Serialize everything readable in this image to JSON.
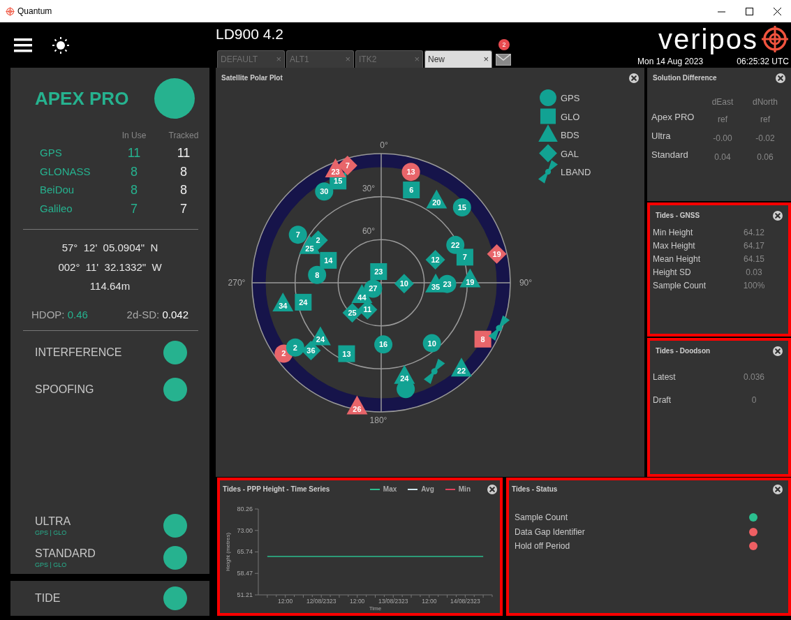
{
  "window": {
    "title": "Quantum"
  },
  "header": {
    "title": "LD900 4.2",
    "tabs": [
      {
        "label": "DEFAULT",
        "close": "×",
        "selected": false
      },
      {
        "label": "ALT1",
        "close": "×",
        "selected": false
      },
      {
        "label": "ITK2",
        "close": "×",
        "selected": false
      },
      {
        "label": "New",
        "close": "×",
        "selected": true
      }
    ],
    "messages": {
      "badge": "2"
    },
    "logo": "veripos",
    "date": "Mon 14 Aug 2023",
    "time": "06:25:32 UTC"
  },
  "receiver": {
    "name": "APEX PRO",
    "color": "#26b28f",
    "columns": [
      "In Use",
      "Tracked"
    ],
    "constellations": [
      {
        "name": "GPS",
        "in_use": "11",
        "tracked": "11"
      },
      {
        "name": "GLONASS",
        "in_use": "8",
        "tracked": "8"
      },
      {
        "name": "BeiDou",
        "in_use": "8",
        "tracked": "8"
      },
      {
        "name": "Galileo",
        "in_use": "7",
        "tracked": "7"
      }
    ],
    "position": [
      "57°  12'  05.0904\"  N",
      "002°  11'  32.1332\"  W",
      "114.64m"
    ],
    "hdop": {
      "label": "HDOP:",
      "value": "0.46"
    },
    "sd": {
      "label": "2d-SD:",
      "value": "0.042"
    },
    "threats": [
      {
        "name": "INTERFERENCE",
        "color": "#26b28f"
      },
      {
        "name": "SPOOFING",
        "color": "#26b28f"
      }
    ],
    "services": [
      {
        "name": "ULTRA",
        "signals": "GPS | GLO",
        "color": "#26b28f"
      },
      {
        "name": "STANDARD",
        "signals": "GPS | GLO",
        "color": "#26b28f"
      }
    ]
  },
  "tide": {
    "name": "TIDE",
    "color": "#26b28f"
  },
  "satellite_plot": {
    "title": "Satellite Polar Plot",
    "azimuth_labels": [
      "0°",
      "90°",
      "180°",
      "270°"
    ],
    "elevation_labels": [
      "30°",
      "60°"
    ],
    "legend": [
      {
        "name": "GPS",
        "kind": "circle"
      },
      {
        "name": "GLO",
        "kind": "square"
      },
      {
        "name": "BDS",
        "kind": "triangle"
      },
      {
        "name": "GAL",
        "kind": "diamond"
      },
      {
        "name": "LBAND",
        "kind": "lband"
      }
    ],
    "satellites": [
      {
        "kind": "circle",
        "label": "13",
        "in_use": false
      },
      {
        "kind": "circle",
        "label": "2",
        "in_use": false
      },
      {
        "kind": "circle",
        "label": "30",
        "in_use": true
      },
      {
        "kind": "circle",
        "label": "15",
        "in_use": true
      },
      {
        "kind": "circle",
        "label": "7",
        "in_use": true
      },
      {
        "kind": "circle",
        "label": "22",
        "in_use": true
      },
      {
        "kind": "circle",
        "label": "8",
        "in_use": true
      },
      {
        "kind": "circle",
        "label": "27",
        "in_use": true
      },
      {
        "kind": "circle",
        "label": "23",
        "in_use": true
      },
      {
        "kind": "circle",
        "label": "16",
        "in_use": true
      },
      {
        "kind": "circle",
        "label": "10",
        "in_use": true
      },
      {
        "kind": "circle",
        "label": "2",
        "in_use": true
      },
      {
        "kind": "circle",
        "in_use": true
      },
      {
        "kind": "square",
        "label": "8",
        "in_use": false
      },
      {
        "kind": "square",
        "label": "15",
        "in_use": true
      },
      {
        "kind": "square",
        "label": "6",
        "in_use": true
      },
      {
        "kind": "square",
        "label": "14",
        "in_use": true
      },
      {
        "kind": "square",
        "label": "23",
        "in_use": true
      },
      {
        "kind": "square",
        "label": "7",
        "in_use": true
      },
      {
        "kind": "square",
        "label": "24",
        "in_use": true
      },
      {
        "kind": "square",
        "label": "13",
        "in_use": true
      },
      {
        "kind": "triangle",
        "label": "23",
        "in_use": false
      },
      {
        "kind": "triangle",
        "label": "26",
        "in_use": false
      },
      {
        "kind": "triangle",
        "label": "20",
        "in_use": true
      },
      {
        "kind": "triangle",
        "label": "25",
        "in_use": true
      },
      {
        "kind": "triangle",
        "label": "19",
        "in_use": true
      },
      {
        "kind": "triangle",
        "label": "35",
        "in_use": true
      },
      {
        "kind": "triangle",
        "label": "44",
        "in_use": true
      },
      {
        "kind": "triangle",
        "label": "34",
        "in_use": true
      },
      {
        "kind": "triangle",
        "label": "24",
        "in_use": true
      },
      {
        "kind": "triangle",
        "label": "22",
        "in_use": true
      },
      {
        "kind": "triangle",
        "label": "24",
        "in_use": true
      },
      {
        "kind": "diamond",
        "label": "7",
        "in_use": false
      },
      {
        "kind": "diamond",
        "label": "19",
        "in_use": false
      },
      {
        "kind": "diamond",
        "label": "2",
        "in_use": true
      },
      {
        "kind": "diamond",
        "label": "12",
        "in_use": true
      },
      {
        "kind": "diamond",
        "label": "10",
        "in_use": true
      },
      {
        "kind": "diamond",
        "label": "25",
        "in_use": true
      },
      {
        "kind": "diamond",
        "label": "11",
        "in_use": true
      },
      {
        "kind": "diamond",
        "label": "36",
        "in_use": true
      },
      {
        "kind": "lband",
        "in_use": true
      },
      {
        "kind": "lband",
        "in_use": true
      }
    ]
  },
  "solution_difference": {
    "title": "Solution Difference",
    "highlighted": false,
    "columns": [
      "dEast",
      "dNorth"
    ],
    "rows": [
      {
        "label": "Apex PRO",
        "values": [
          "ref",
          "ref"
        ]
      },
      {
        "label": "Ultra",
        "values": [
          "-0.00",
          "-0.02"
        ]
      },
      {
        "label": "Standard",
        "values": [
          "0.04",
          "0.06"
        ]
      }
    ]
  },
  "tides_gnss": {
    "title": "Tides - GNSS",
    "highlighted": true,
    "rows": [
      {
        "label": "Min Height",
        "value": "64.12"
      },
      {
        "label": "Max Height",
        "value": "64.17"
      },
      {
        "label": "Mean Height",
        "value": "64.15"
      },
      {
        "label": "Height SD",
        "value": "0.03"
      },
      {
        "label": "Sample Count",
        "value": "100%"
      }
    ]
  },
  "tides_doodson": {
    "title": "Tides - Doodson",
    "highlighted": true,
    "rows": [
      {
        "label": "Latest",
        "value": "0.036"
      },
      {
        "label": "Draft",
        "value": "0"
      }
    ]
  },
  "tides_time_series": {
    "title": "Tides - PPP Height - Time Series",
    "highlighted": true,
    "chart_data": {
      "type": "line",
      "ylabel": "Height (metres)",
      "xlabel": "Time",
      "categories": [
        null,
        "12:00",
        null,
        "12/08/2323",
        null,
        "12:00",
        null,
        "13/08/2323",
        null,
        "12:00",
        null,
        "14/08/2323",
        null
      ],
      "ylim": [
        51.21,
        80.26
      ],
      "yticks": [
        {
          "value": 51.21,
          "label": "51.21"
        },
        {
          "value": 58.47,
          "label": "58.47"
        },
        {
          "value": 65.74,
          "label": "65.74"
        },
        {
          "value": 73,
          "label": "73.00"
        },
        {
          "value": 80.26,
          "label": "80.26"
        }
      ],
      "series": [
        {
          "name": "Max",
          "color": "#2bbf8f",
          "values": [
            64.2,
            64.2,
            64.2,
            64.2,
            64.2,
            64.2,
            64.2,
            64.2,
            64.2,
            64.2,
            64.2,
            64.2,
            64.2
          ]
        },
        {
          "name": "Avg",
          "color": "#cfe6ee",
          "values": [
            null,
            null,
            null,
            null,
            null,
            null,
            null,
            null,
            null,
            null,
            null,
            null,
            null
          ]
        },
        {
          "name": "Min",
          "color": "#e0415c",
          "values": [
            null,
            null,
            null,
            null,
            null,
            null,
            null,
            null,
            null,
            null,
            null,
            null,
            null
          ]
        }
      ],
      "legend": "top"
    }
  },
  "tides_status": {
    "title": "Tides - Status",
    "highlighted": true,
    "items": [
      {
        "label": "Sample Count",
        "color": "#2bbf8f"
      },
      {
        "label": "Data Gap Identifier",
        "color": "#ef5f63"
      },
      {
        "label": "Hold off Period",
        "color": "#ef5f63"
      }
    ]
  }
}
